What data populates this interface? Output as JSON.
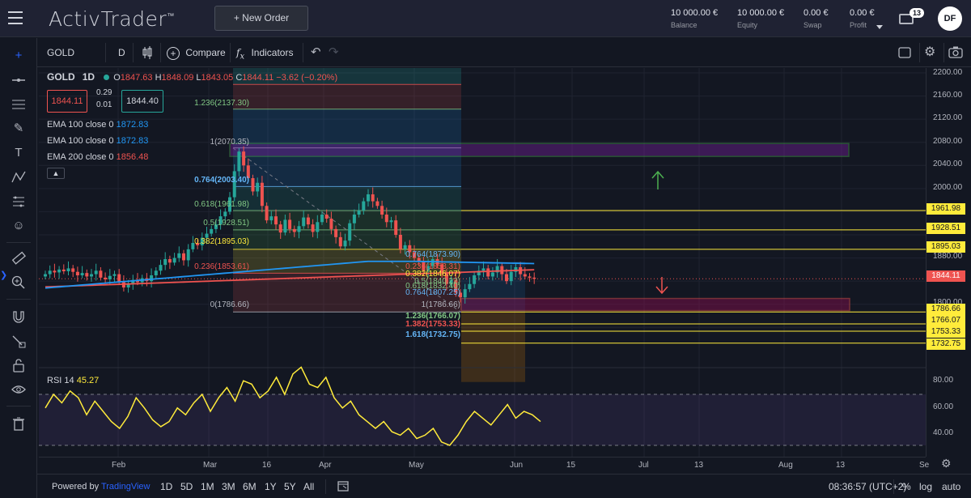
{
  "app": {
    "logo": "ActivTrader",
    "logo_mark": "™",
    "new_order_label": "+ New Order"
  },
  "account": [
    {
      "value": "10 000.00 €",
      "label": "Balance"
    },
    {
      "value": "10 000.00 €",
      "label": "Equity"
    },
    {
      "value": "0.00 €",
      "label": "Swap"
    },
    {
      "value": "0.00 €",
      "label": "Profit"
    }
  ],
  "notifications": {
    "count": "13"
  },
  "user": {
    "initials": "DF"
  },
  "toolbar": {
    "symbol": "GOLD",
    "interval": "D",
    "compare": "Compare",
    "indicators": "Indicators"
  },
  "legend": {
    "symbol": "GOLD",
    "interval": "1D",
    "open_label": "O",
    "open": "1847.63",
    "high_label": "H",
    "high": "1848.09",
    "low_label": "L",
    "low": "1843.05",
    "close_label": "C",
    "close": "1844.11",
    "change": "−3.62 (−0.20%)",
    "sell": "1844.11",
    "buy": "1844.40",
    "spread_top": "0.29",
    "spread_bottom": "0.01",
    "ema": [
      {
        "name": "EMA 100 close 0",
        "value": "1872.83",
        "color": "#2196f3"
      },
      {
        "name": "EMA 100 close 0",
        "value": "1872.83",
        "color": "#2196f3"
      },
      {
        "name": "EMA 200 close 0",
        "value": "1856.48",
        "color": "#ef5350"
      }
    ],
    "rsi_label": "RSI 14",
    "rsi_value": "45.27"
  },
  "fib_main": [
    {
      "text": "1.236(2137.30)",
      "color": "#81c784"
    },
    {
      "text": "1(2070.35)",
      "color": "#b2b5be"
    },
    {
      "text": "0.764(2003.40)",
      "color": "#64b5f6"
    },
    {
      "text": "0.618(1961.98)",
      "color": "#81c784"
    },
    {
      "text": "0.5(1928.51)",
      "color": "#81c784"
    },
    {
      "text": "0.382(1895.03)",
      "color": "#ffeb3b"
    },
    {
      "text": "0.236(1853.61)",
      "color": "#ef5350"
    },
    {
      "text": "0(1786.66)",
      "color": "#b2b5be"
    }
  ],
  "fib_second": [
    {
      "text": "0.764(1873.90)",
      "color": "#64b5f6"
    },
    {
      "text": "0.236(1853.31)",
      "color": "#ef5350"
    },
    {
      "text": "0.382(1846.07)",
      "color": "#ffeb3b"
    },
    {
      "text": "0.5(1840.22)",
      "color": "#81c784"
    },
    {
      "text": "0.618(1832.40)",
      "color": "#81c784"
    },
    {
      "text": "0.764(1807.25)",
      "color": "#64b5f6"
    },
    {
      "text": "1(1786.66)",
      "color": "#b2b5be"
    },
    {
      "text": "1.236(1766.07)",
      "color": "#81c784"
    },
    {
      "text": "1.382(1753.33)",
      "color": "#ef5350"
    },
    {
      "text": "1.618(1732.75)",
      "color": "#64b5f6"
    }
  ],
  "price_axis": [
    "2200.00",
    "2160.00",
    "2120.00",
    "2080.00",
    "2040.00",
    "2000.00",
    "1880.00",
    "1800.00"
  ],
  "price_markers": [
    {
      "text": "1961.98",
      "kind": "yellow"
    },
    {
      "text": "1928.51",
      "kind": "yellow"
    },
    {
      "text": "1895.03",
      "kind": "yellow"
    },
    {
      "text": "1844.11",
      "kind": "red"
    },
    {
      "text": "1786.66",
      "kind": "yellow"
    },
    {
      "text": "1766.07",
      "kind": "yellow"
    },
    {
      "text": "1753.33",
      "kind": "yellow"
    },
    {
      "text": "1732.75",
      "kind": "yellow"
    }
  ],
  "rsi_axis": [
    "80.00",
    "60.00",
    "40.00"
  ],
  "time_axis": [
    "Feb",
    "Mar",
    "16",
    "Apr",
    "May",
    "Jun",
    "15",
    "Jul",
    "13",
    "Aug",
    "13",
    "Se"
  ],
  "footer": {
    "powered": "Powered by",
    "tv": "TradingView",
    "ranges": [
      "1D",
      "5D",
      "1M",
      "3M",
      "6M",
      "1Y",
      "5Y",
      "All"
    ],
    "time": "08:36:57 (UTC+2)",
    "pct": "%",
    "log": "log",
    "auto": "auto"
  },
  "colors": {
    "ema100": "#2196f3",
    "ema200": "#ef5350",
    "rsi": "#ffeb3b",
    "up": "#26a69a",
    "down": "#ef5350"
  }
}
